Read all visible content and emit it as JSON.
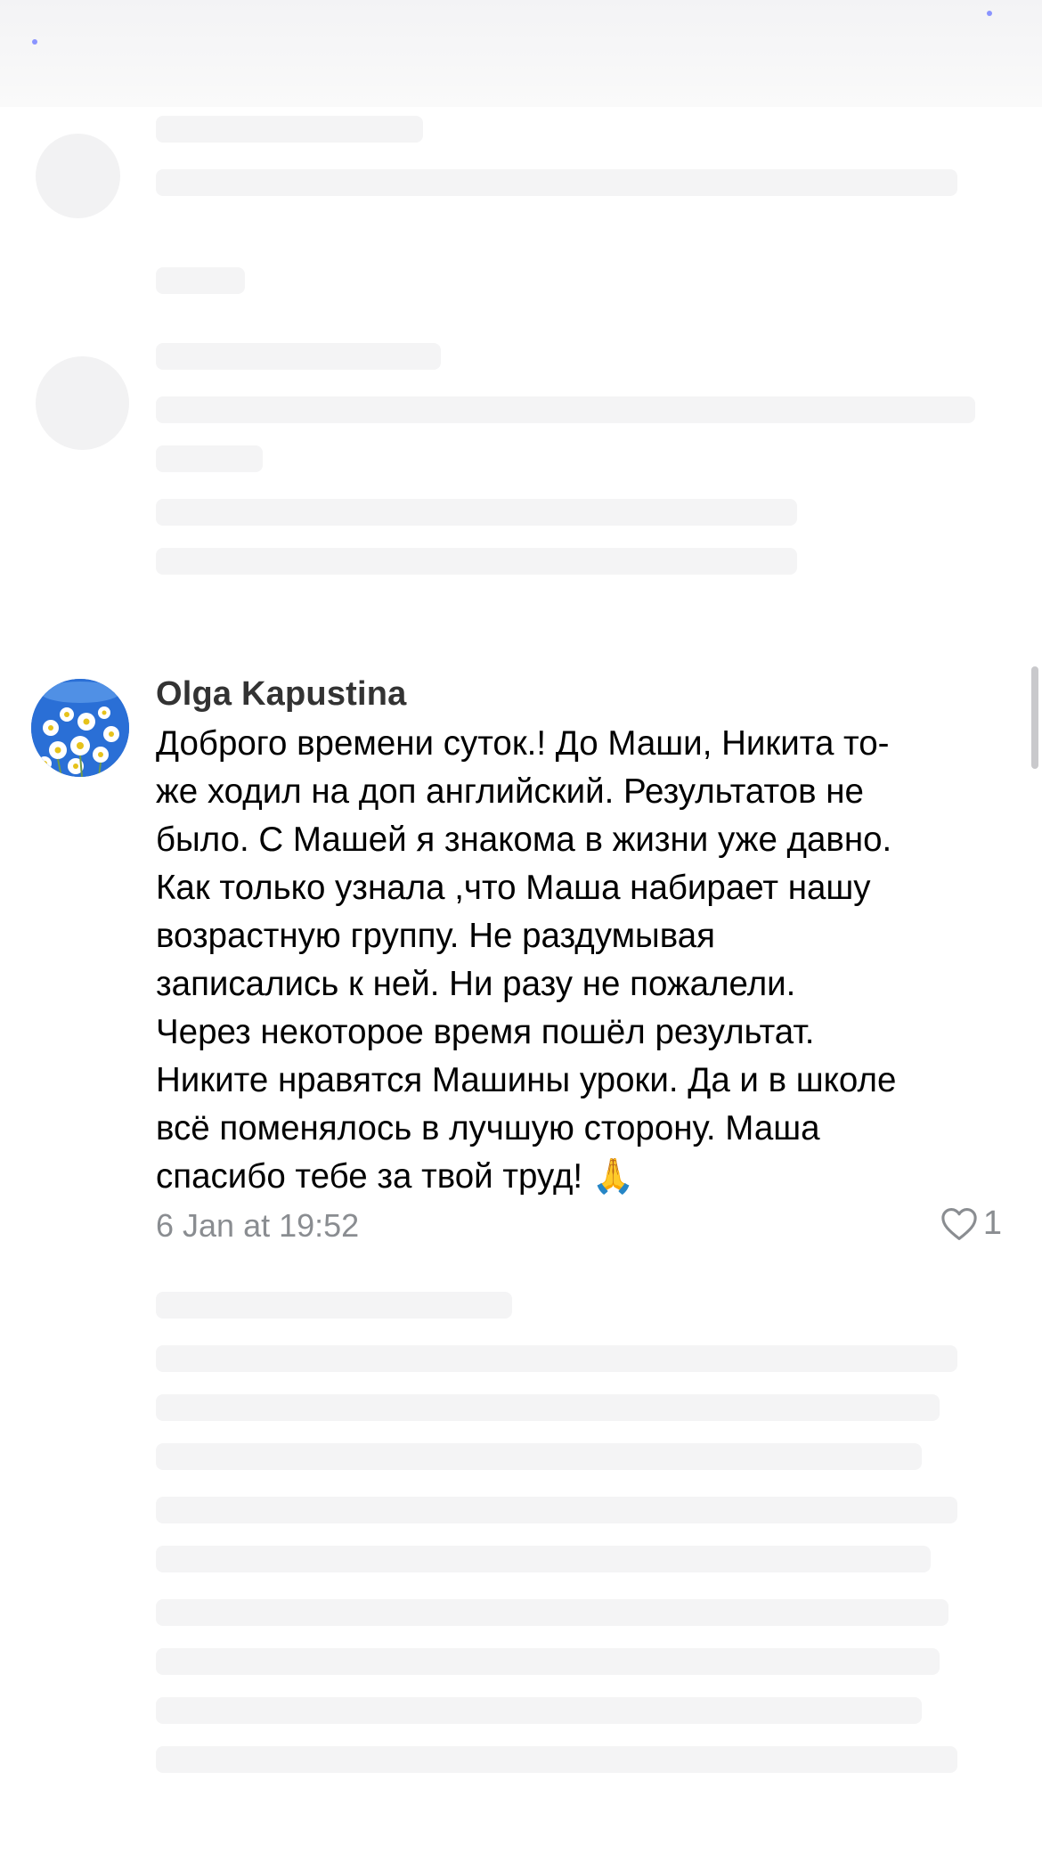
{
  "comment": {
    "author": "Olga Kapustina",
    "text": "Доброго времени суток.! До Маши, Никита то-\nже ходил на  доп английский. Результатов не\nбыло. С Машей я знакома в жизни уже давно.\nКак только узнала ,что Маша набирает нашу\nвозрастную группу. Не раздумывая\nзаписались к ней. Ни разу не пожалели.\nЧерез некоторое время пошёл результат.\nНиките нравятся Машины уроки. Да и в школе\nвсё  поменялось в лучшую сторону. Маша\nспасибо тебе за твой труд! ",
    "emoji": "🙏",
    "timestamp": "6 Jan at 19:52",
    "like_count": "1"
  },
  "icons": {
    "like": "heart-icon",
    "avatar": "avatar-daisies"
  }
}
